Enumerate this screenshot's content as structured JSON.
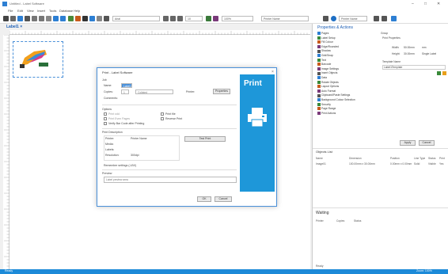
{
  "window": {
    "title": "Untitled - Label Software",
    "minimize": "–",
    "maximize": "□",
    "close": "✕"
  },
  "menu": [
    "File",
    "Edit",
    "View",
    "Insert",
    "Tools",
    "Database",
    "Help"
  ],
  "toolbar": {
    "font_combo": "Arial",
    "size_combo": "10",
    "zoom_combo": "100%",
    "printer_combo": "Printer Name",
    "colors": {
      "accent": "#1c8ad8",
      "print": "#1e97d9"
    }
  },
  "doc_tab": {
    "label": "Label1",
    "close": "×"
  },
  "dialog": {
    "title": "Print - Label Software",
    "close": "×",
    "section_job": "Job",
    "name_label": "Name:",
    "name_value": "Label1",
    "copies_label": "Copies:",
    "copies_value": "1",
    "collate_label": "Collated",
    "printer_label": "Printer:",
    "printer_value": "Printer Name",
    "prefs_button": "Properties",
    "comments_label": "Comments:",
    "options_label": "Options",
    "opt1": "Print odd",
    "opt2": "Print Even Pages",
    "opt3": "Print file",
    "opt4": "Reverse Print",
    "opt5": "Verify Bar Code after Printing",
    "opt6": "Collate Copies",
    "print_description": "Print Description",
    "desc_rows": [
      {
        "k": "Printer:",
        "v": "Printer Name"
      },
      {
        "k": "Media:",
        "v": ""
      },
      {
        "k": "Labels:",
        "v": ""
      },
      {
        "k": "Resolution:",
        "v": "300dpi"
      }
    ],
    "test_button": "Test Print",
    "remember_label": "Remember settings (.LBX)",
    "preview_label": "Preview",
    "preview_value": "Label preview area",
    "print_panel_text": "Print",
    "ok_button": "OK",
    "cancel_button": "Cancel"
  },
  "right_panel": {
    "title": "Properties & Actions",
    "tree": [
      "Pages",
      "Label Setup",
      "Fill Colour",
      "Edge/Rounded",
      "Shadow",
      "Grid/Snap",
      "Text",
      "Barcode",
      "Image Settings",
      "Insert Objects",
      "Data",
      "Rotate Objects",
      "Layout Options",
      "Auto Format",
      "Clipboard/Paste Settings",
      "Background Colour Selection",
      "Security",
      "Page Range",
      "Print Actions"
    ],
    "props": {
      "group": "Group",
      "print_prop": "Print Properties",
      "width_label": "Width:",
      "width_value": "50.00mm",
      "height_label": "Height:",
      "height_value": "30.00mm",
      "units": "mm",
      "single": "Single Label",
      "template": "Template Name",
      "template_value": "Label1Template"
    },
    "apply": "Apply",
    "cancel": "Cancel",
    "objects_title": "Objects List",
    "obj_headers": [
      "Name",
      "Dimension",
      "Position",
      "Line Type",
      "Status",
      "Print"
    ],
    "obj_rows": [
      [
        "Image01",
        "100.00mm x 30.00mm",
        "0.00mm x 0.00mm",
        "Solid",
        "Visible",
        "Yes"
      ]
    ],
    "waiting_title": "Waiting",
    "wait_headers": [
      "Printer",
      "Copies",
      "Status"
    ],
    "wait_footer": "Ready"
  },
  "status": {
    "left": "Ready",
    "right": "Zoom: 100%"
  }
}
